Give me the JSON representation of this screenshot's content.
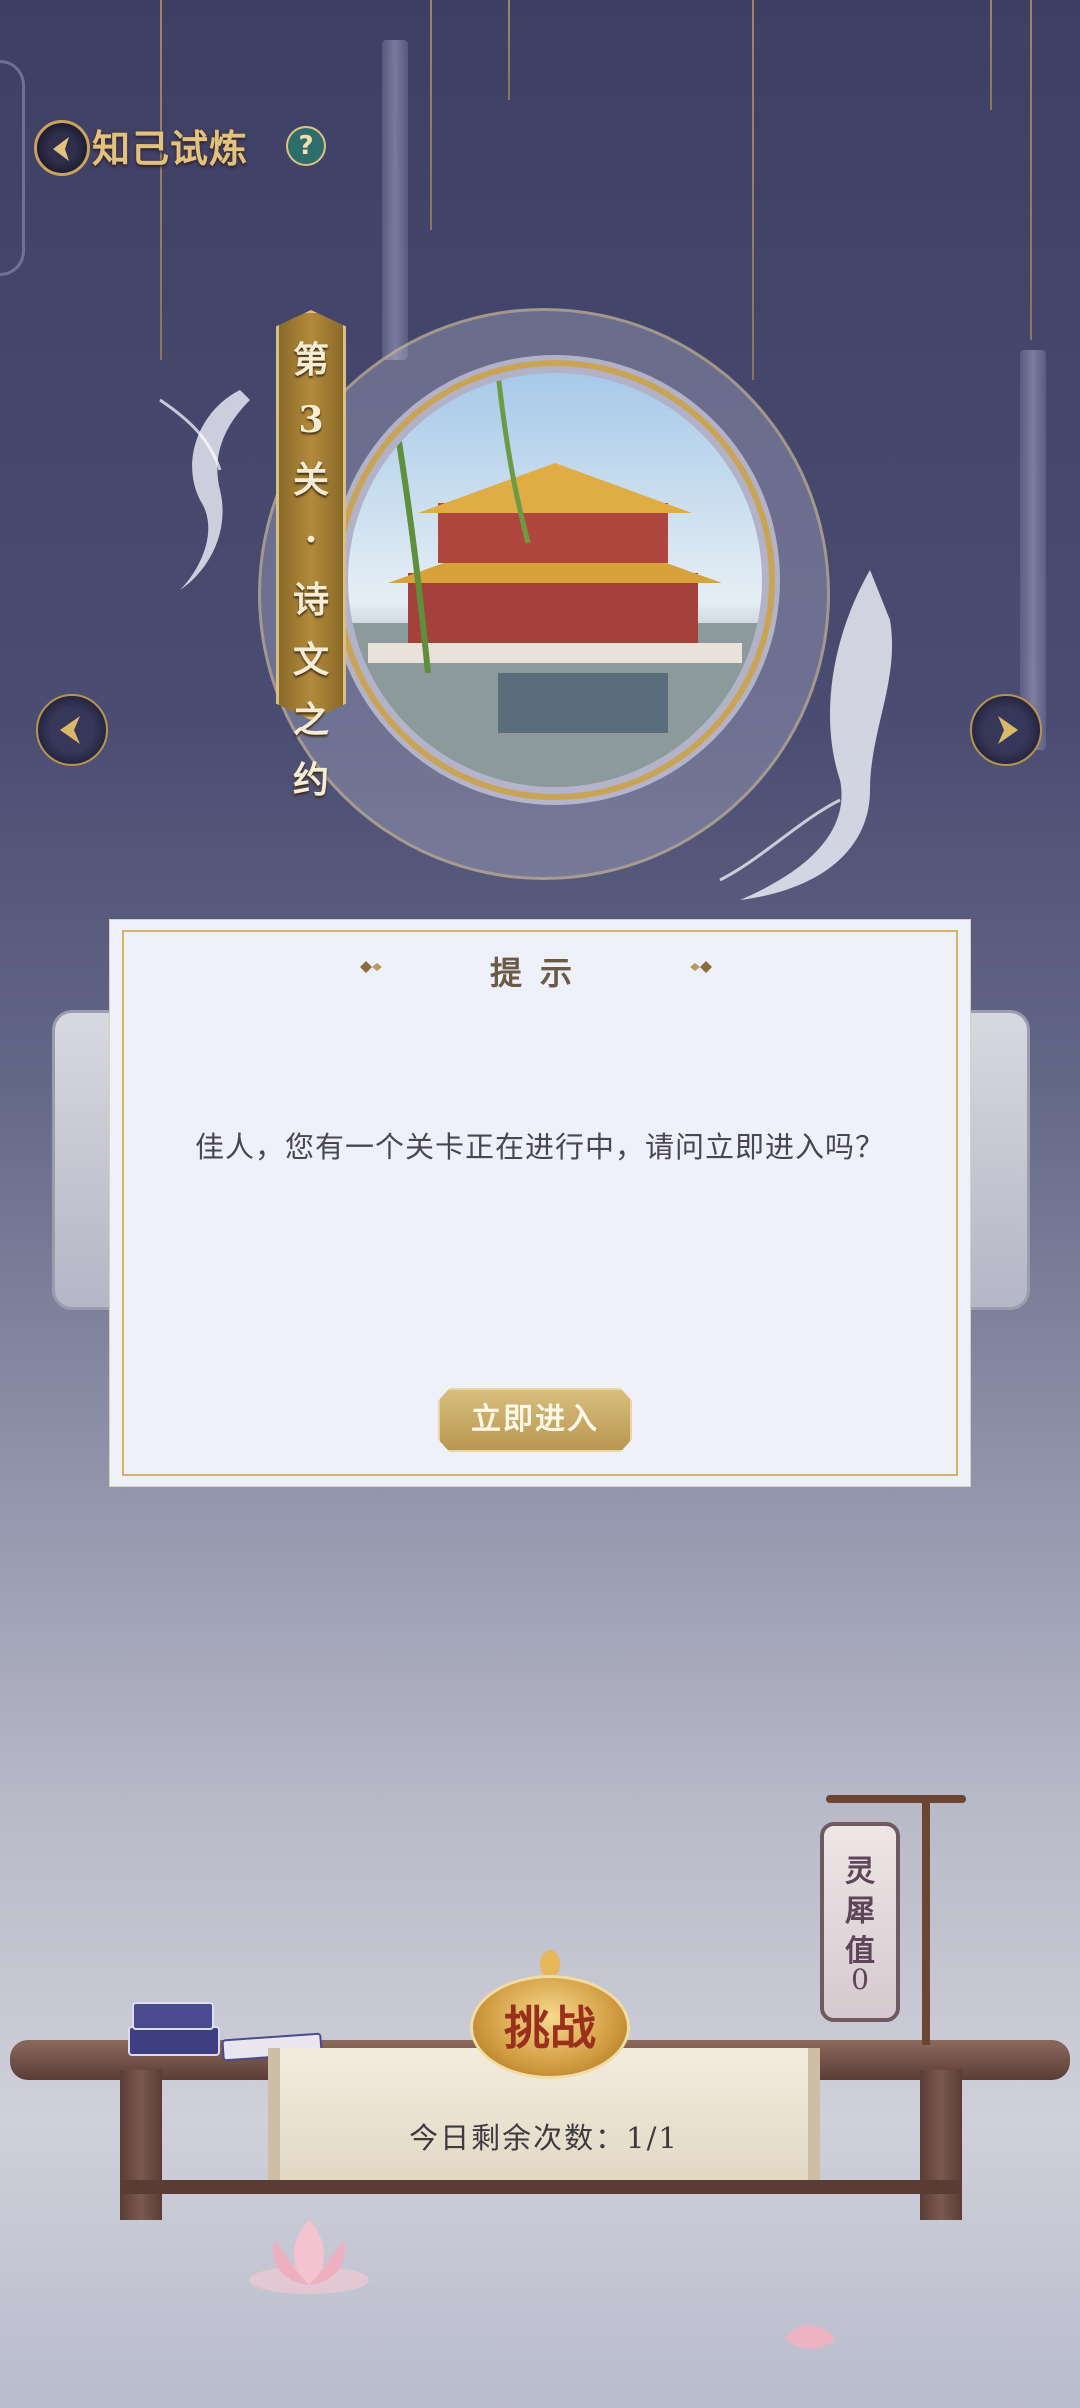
{
  "header": {
    "title": "知己试炼",
    "help_label": "?"
  },
  "level": {
    "chars": [
      "第",
      "3",
      "关",
      "·",
      "诗",
      "文",
      "之",
      "约"
    ]
  },
  "lantern": {
    "chars": [
      "灵",
      "犀",
      "值"
    ],
    "value": "0"
  },
  "challenge": {
    "label": "挑战",
    "remaining": "今日剩余次数：1/1"
  },
  "dialog": {
    "title": "提示",
    "message": "佳人，您有一个关卡正在进行中，请问立即进入吗？",
    "enter_label": "立即进入"
  },
  "colors": {
    "accent_gold": "#c9a457",
    "modal_bg": "#eef1f9",
    "challenge_text": "#9a2f1c"
  }
}
